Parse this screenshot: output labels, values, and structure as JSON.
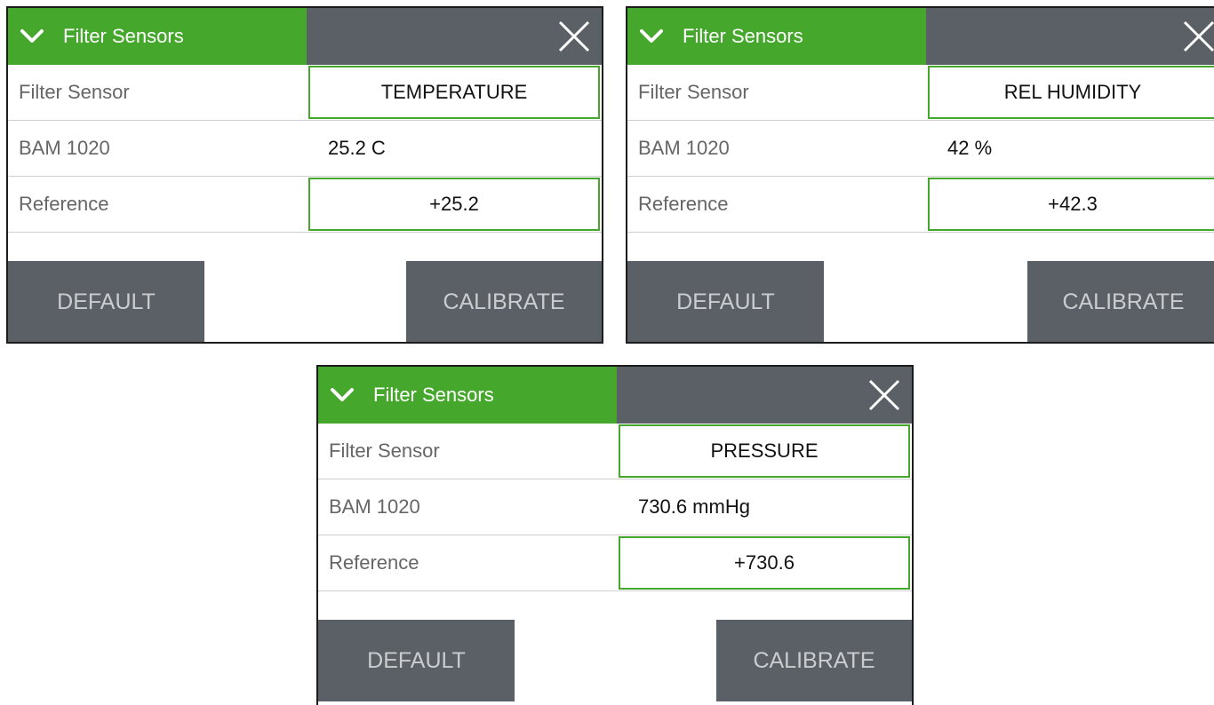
{
  "panels": [
    {
      "title": "Filter Sensors",
      "rows": {
        "sensor_label": "Filter Sensor",
        "sensor_value": "TEMPERATURE",
        "bam_label": "BAM 1020",
        "bam_value": "25.2 C",
        "reference_label": "Reference",
        "reference_value": "+25.2"
      },
      "buttons": {
        "default": "DEFAULT",
        "calibrate": "CALIBRATE"
      }
    },
    {
      "title": "Filter Sensors",
      "rows": {
        "sensor_label": "Filter Sensor",
        "sensor_value": "REL HUMIDITY",
        "bam_label": "BAM 1020",
        "bam_value": "42 %",
        "reference_label": "Reference",
        "reference_value": "+42.3"
      },
      "buttons": {
        "default": "DEFAULT",
        "calibrate": "CALIBRATE"
      }
    },
    {
      "title": "Filter Sensors",
      "rows": {
        "sensor_label": "Filter Sensor",
        "sensor_value": "PRESSURE",
        "bam_label": "BAM 1020",
        "bam_value": "730.6 mmHg",
        "reference_label": "Reference",
        "reference_value": "+730.6"
      },
      "buttons": {
        "default": "DEFAULT",
        "calibrate": "CALIBRATE"
      }
    }
  ],
  "icons": {
    "collapse": "chevron-down-icon",
    "close": "close-icon"
  },
  "colors": {
    "accent_green": "#45a82c",
    "header_gray": "#5a6065",
    "button_text": "#c9cdd0"
  }
}
